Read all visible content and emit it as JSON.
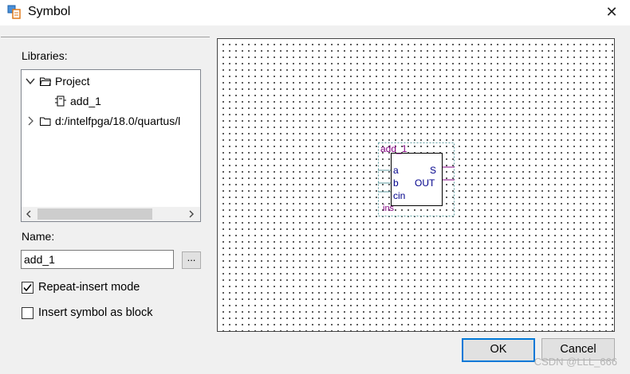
{
  "window": {
    "title": "Symbol",
    "close_glyph": "✕"
  },
  "libraries": {
    "label": "Libraries:",
    "tree": [
      {
        "label": "Project",
        "expanded": true,
        "icon": "folder-icon"
      },
      {
        "label": "add_1",
        "selected": true,
        "icon": "component-icon"
      },
      {
        "label": "d:/intelfpga/18.0/quartus/l",
        "expanded": false,
        "icon": "folder-icon"
      }
    ]
  },
  "name": {
    "label": "Name:",
    "value": "add_1",
    "browse_label": "..."
  },
  "options": {
    "repeat_insert": {
      "label": "Repeat-insert mode",
      "checked": true
    },
    "insert_block": {
      "label": "Insert symbol as block",
      "checked": false
    }
  },
  "symbol": {
    "name": "add_1",
    "instance": "ins",
    "inputs": [
      "a",
      "b",
      "cin"
    ],
    "outputs": [
      "S",
      "OUT"
    ]
  },
  "buttons": {
    "ok": "OK",
    "cancel": "Cancel"
  },
  "watermark": "CSDN @LLL_666",
  "colors": {
    "pin_text": "#00008b",
    "symbol_label": "#800080",
    "selection": "#cce8ff",
    "default_button_border": "#0078d7"
  }
}
